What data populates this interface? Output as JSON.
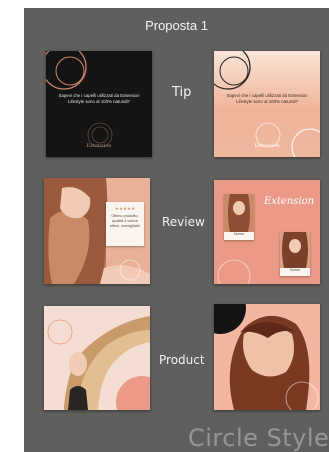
{
  "board": {
    "title": "Proposta 1",
    "style_label": "Circle Style"
  },
  "rows": [
    {
      "label": "Tip"
    },
    {
      "label": "Review"
    },
    {
      "label": "Product"
    }
  ],
  "tip_dark": {
    "text": "Sapevi che i capelli utilizzati da Extension Lifestyle sono al 100% naturali?",
    "brand": "Extension"
  },
  "tip_light": {
    "text": "Sapevi che i capelli utilizzati da Extension Lifestyle sono al 100% naturali?",
    "brand": "Extension"
  },
  "review_card": {
    "stars": "★★★★★",
    "text": "Ottimo prodotto, qualità e colore ottimi, consigliato!"
  },
  "review_grid": {
    "brand": "Extension",
    "photo_caption_1": "Nome",
    "photo_caption_2": "Nome"
  },
  "colors": {
    "board_bg": "#5f5f5d",
    "peach": "#f0b49a",
    "salmon": "#ea9a86",
    "blush": "#f6d7cc",
    "dark": "#141414"
  }
}
